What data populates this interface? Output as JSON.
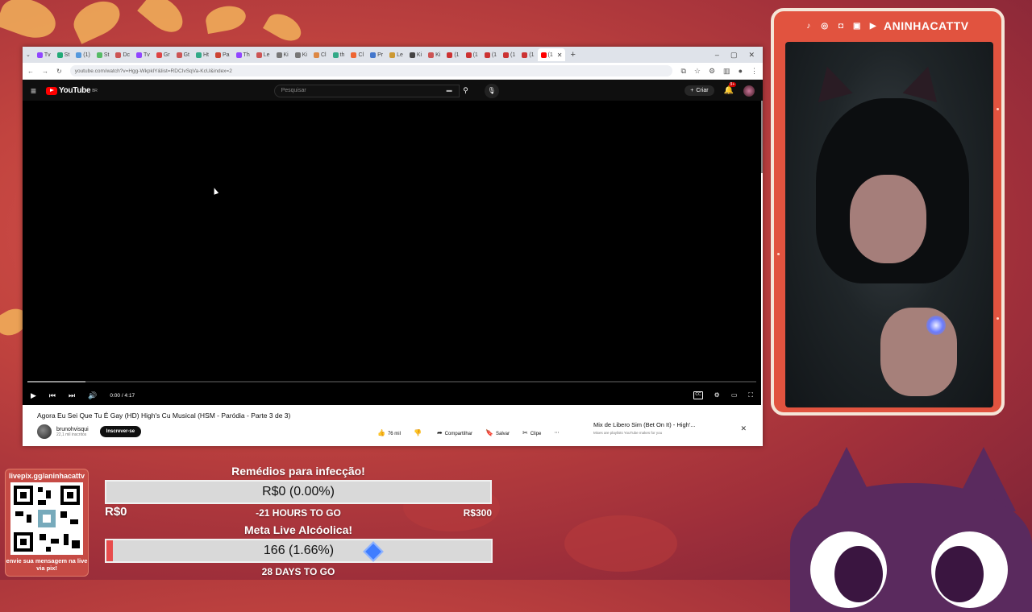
{
  "browser": {
    "tabs": [
      "Tv",
      "St",
      "(1)",
      "St",
      "Dc",
      "Tv",
      "Gr",
      "Gt",
      "Ht",
      "Pa",
      "Th",
      "Le",
      "Ki",
      "Ki",
      "Cl",
      "th",
      "Cl",
      "Pr",
      "Le",
      "Ki",
      "Ki",
      "(1",
      "(1",
      "(1",
      "(1",
      "(1",
      "(1"
    ],
    "active_tab_index": 26,
    "url": "youtube.com/watch?v=Hgg-WkpklY&list=RDCIvSqVa-KcU&index=2"
  },
  "youtube": {
    "logo": "YouTube",
    "logo_sup": "BR",
    "search_placeholder": "Pesquisar",
    "create_label": "Criar",
    "notif_badge": "9+",
    "player": {
      "time": "0:00 / 4:17",
      "progress_fraction": 0.0,
      "buffered_fraction": 0.08
    },
    "video": {
      "title": "Agora Eu Sei Que Tu É Gay (HD) High's Cu Musical (HSM - Paródia - Parte 3 de 3)",
      "channel": "brunohvisqui",
      "subs": "22,1 mil inscritos",
      "subscribe_label": "Inscrever-se",
      "likes": "76 mil",
      "share_label": "Compartilhar",
      "save_label": "Salvar",
      "clip_label": "Clipe"
    },
    "mix": {
      "title": "Mix de Libero Sim (Bet On It) - High'...",
      "subtitle": "Mixes are playlists YouTube makes for you"
    }
  },
  "stream": {
    "channel_name": "ANINHACATTV",
    "pix": {
      "label": "livepix.gg/aninhacattv",
      "footer": "envie sua mensagem na live via pix!"
    },
    "goal1": {
      "title": "Remédios para infecção!",
      "value": "R$0 (0.00%)",
      "fraction": 0.0,
      "min": "R$0",
      "max": "R$300",
      "time_left": "-21 HOURS TO GO"
    },
    "goal2": {
      "title": "Meta Live Alcóolica!",
      "value": "166 (1.66%)",
      "fraction": 0.0166,
      "time_left": "28 DAYS TO GO"
    }
  },
  "colors": {
    "yt_red": "#ff0000",
    "goal_fill": "#e84c4c",
    "cam_border": "#e1533f"
  }
}
